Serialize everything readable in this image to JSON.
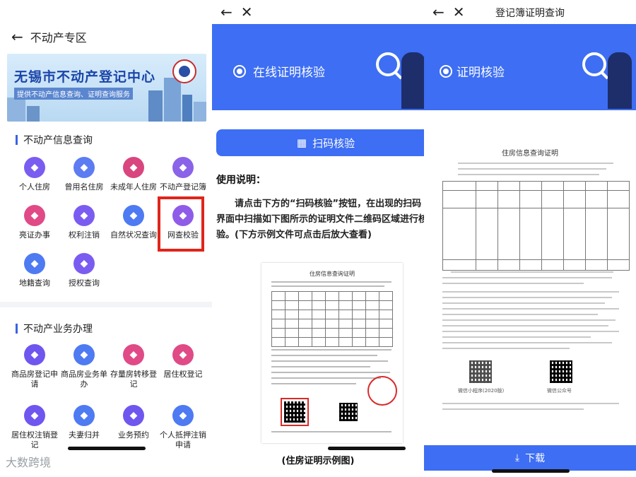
{
  "panel1": {
    "title": "不动产专区",
    "banner": {
      "title": "无锡市不动产登记中心",
      "subtitle": "提供不动产信息查询、证明查询服务"
    },
    "section1": {
      "title": "不动产信息查询",
      "items": [
        {
          "label": "个人住房",
          "icon": "person-house-icon",
          "color": "#7b5cf0"
        },
        {
          "label": "曾用名住房",
          "icon": "id-card-icon",
          "color": "#5d7cf2"
        },
        {
          "label": "未成年人住房",
          "icon": "child-icon",
          "color": "#d9457e"
        },
        {
          "label": "不动产登记簿",
          "icon": "book-icon",
          "color": "#8a63e8"
        },
        {
          "label": "亮证办事",
          "icon": "certificate-icon",
          "color": "#e04a86"
        },
        {
          "label": "权利注销",
          "icon": "logout-icon",
          "color": "#7b5cf0"
        },
        {
          "label": "自然状况查询",
          "icon": "globe-icon",
          "color": "#4e7af2"
        },
        {
          "label": "网查校验",
          "icon": "scan-icon",
          "color": "#8f5ce8"
        },
        {
          "label": "地籍查询",
          "icon": "grid-doc-icon",
          "color": "#4e7af2"
        },
        {
          "label": "授权查询",
          "icon": "authorize-icon",
          "color": "#7b5cf0"
        }
      ]
    },
    "section2": {
      "title": "不动产业务办理",
      "items": [
        {
          "label": "商品房登记申请",
          "icon": "house-doc-icon",
          "color": "#6f56ef"
        },
        {
          "label": "商品房业务单办",
          "icon": "doc-person-icon",
          "color": "#4e7af2"
        },
        {
          "label": "存量房转移登记",
          "icon": "transfer-house-icon",
          "color": "#e04a86"
        },
        {
          "label": "居住权登记",
          "icon": "home-key-icon",
          "color": "#e04a86"
        },
        {
          "label": "居住权注销登记",
          "icon": "home-cancel-icon",
          "color": "#6f56ef"
        },
        {
          "label": "夫妻归并",
          "icon": "couple-icon",
          "color": "#4e7af2"
        },
        {
          "label": "业务预约",
          "icon": "calendar-icon",
          "color": "#6f56ef"
        },
        {
          "label": "个人抵押注销申请",
          "icon": "mortgage-icon",
          "color": "#4e7af2"
        }
      ]
    },
    "watermark": "大数跨境"
  },
  "panel2": {
    "hero_title": "在线证明核验",
    "scan_button": "扫码核验",
    "howto_title": "使用说明：",
    "instructions": "请点击下方的“扫码核验”按钮，在出现的扫码界面中扫描如下图所示的证明文件二维码区域进行核验。(下方示例文件可点击后放大查看)",
    "sample_doc_title": "住房信息查询证明",
    "caption": "(住房证明示例图)"
  },
  "panel3": {
    "title": "登记簿证明查询",
    "hero_title": "证明核验",
    "doc_title": "住房信息查询证明",
    "qr1_caption": "微信小程序(2020版)",
    "qr2_caption": "微信公众号",
    "download_label": "下载"
  }
}
